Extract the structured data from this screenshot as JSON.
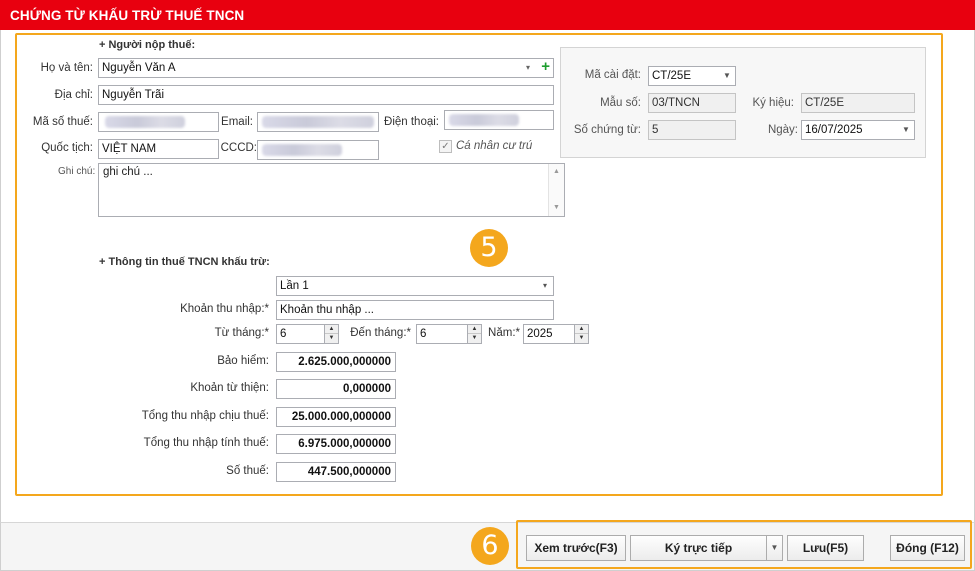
{
  "window": {
    "title": "CHỨNG TỪ KHẤU TRỪ THUẾ TNCN"
  },
  "taxpayer": {
    "section_title": "+ Người nộp thuế:",
    "fullname_label": "Họ và tên:",
    "fullname_value": "Nguyễn Văn A",
    "address_label": "Địa chỉ:",
    "address_value": "Nguyễn Trãi",
    "taxcode_label": "Mã số thuế:",
    "email_label": "Email:",
    "phone_label": "Điện thoại:",
    "nationality_label": "Quốc tịch:",
    "nationality_value": "VIỆT NAM",
    "cccd_label": "CCCD:",
    "resident_label": "Cá nhân cư trú",
    "resident_checked": true,
    "note_label": "Ghi chú:",
    "note_value": "ghi chú ..."
  },
  "voucher": {
    "setup_code_label": "Mã cài đặt:",
    "setup_code_value": "CT/25E",
    "template_label": "Mẫu số:",
    "template_value": "03/TNCN",
    "symbol_label": "Ký hiệu:",
    "symbol_value": "CT/25E",
    "number_label": "Số chứng từ:",
    "number_value": "5",
    "date_label": "Ngày:",
    "date_value": "16/07/2025"
  },
  "tax_info": {
    "section_title": "+ Thông tin thuế TNCN khấu trừ:",
    "period_value": "Lần 1",
    "income_label": "Khoản thu nhập:*",
    "income_value": "Khoản thu nhập ...",
    "from_month_label": "Từ tháng:*",
    "from_month_value": "6",
    "to_month_label": "Đến tháng:*",
    "to_month_value": "6",
    "year_label": "Năm:*",
    "year_value": "2025",
    "insurance_label": "Bảo hiểm:",
    "insurance_value": "2.625.000,000000",
    "charity_label": "Khoản từ thiện:",
    "charity_value": "0,000000",
    "taxable_income_label": "Tổng thu nhập chịu thuế:",
    "taxable_income_value": "25.000.000,000000",
    "assessable_income_label": "Tổng thu nhập tính thuế:",
    "assessable_income_value": "6.975.000,000000",
    "tax_amount_label": "Số thuế:",
    "tax_amount_value": "447.500,000000"
  },
  "buttons": {
    "preview": "Xem trước(F3)",
    "sign": "Ký trực tiếp",
    "save": "Lưu(F5)",
    "close": "Đóng (F12)"
  },
  "annotations": {
    "badge_form": "5",
    "badge_buttons": "6"
  },
  "colors": {
    "title_bar": "#e8000f",
    "highlight": "#f4a71d",
    "add_icon": "#1e9e2f"
  }
}
